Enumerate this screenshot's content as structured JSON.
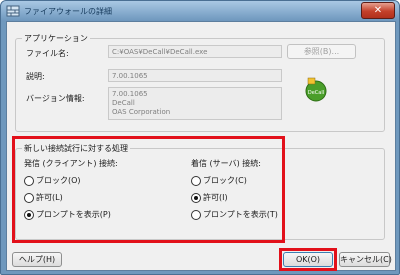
{
  "window": {
    "title": "ファイアウォールの詳細",
    "close_glyph": "✕"
  },
  "app_group": {
    "legend": "アプリケーション",
    "filename_label": "ファイル名:",
    "filename_value": "C:¥OAS¥DeCall¥DeCall.exe",
    "browse_label": "参照(B)...",
    "description_label": "説明:",
    "description_value": "7.00.1065",
    "version_label": "バージョン情報:",
    "version_lines": [
      "7.00.1065",
      "DeCall",
      "OAS Corporation"
    ],
    "app_icon_text": "DeCall"
  },
  "conn_group": {
    "legend": "新しい接続試行に対する処理",
    "outbound": {
      "label": "発信 (クライアント) 接続:",
      "options": [
        {
          "label": "ブロック(O)",
          "checked": false
        },
        {
          "label": "許可(L)",
          "checked": false
        },
        {
          "label": "プロンプトを表示(P)",
          "checked": true
        }
      ]
    },
    "inbound": {
      "label": "着信 (サーバ) 接続:",
      "options": [
        {
          "label": "ブロック(C)",
          "checked": false
        },
        {
          "label": "許可(I)",
          "checked": true
        },
        {
          "label": "プロンプトを表示(T)",
          "checked": false
        }
      ]
    }
  },
  "footer": {
    "help_label": "ヘルプ(H)",
    "ok_label": "OK(O)",
    "cancel_label": "キャンセル(C)"
  },
  "colors": {
    "highlight": "#e2101a",
    "title_bar": "#6f98bd",
    "app_icon_green": "#4a9e2a"
  }
}
